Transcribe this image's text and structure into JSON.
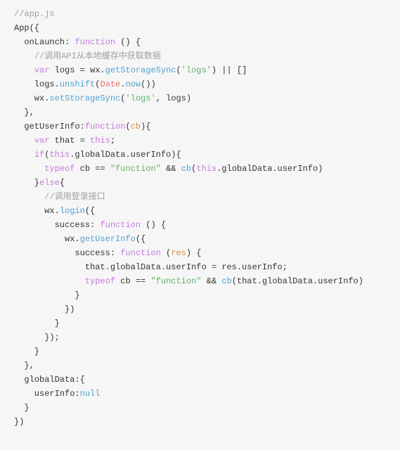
{
  "code": {
    "lines": [
      [
        [
          "c",
          "//app.js"
        ]
      ],
      [
        [
          "id",
          "App"
        ],
        [
          "op",
          "({"
        ]
      ],
      [
        [
          "id",
          "  onLaunch"
        ],
        [
          "op",
          ": "
        ],
        [
          "kw",
          "function"
        ],
        [
          "op",
          " () {"
        ]
      ],
      [
        [
          "c",
          "    //调用API从本地缓存中获取数据"
        ]
      ],
      [
        [
          "op",
          "    "
        ],
        [
          "kw",
          "var"
        ],
        [
          "op",
          " logs = wx."
        ],
        [
          "fn",
          "getStorageSync"
        ],
        [
          "op",
          "("
        ],
        [
          "s",
          "'logs'"
        ],
        [
          "op",
          ") || []"
        ]
      ],
      [
        [
          "op",
          "    logs."
        ],
        [
          "fn",
          "unshift"
        ],
        [
          "op",
          "("
        ],
        [
          "ob",
          "Date"
        ],
        [
          "op",
          "."
        ],
        [
          "fn",
          "now"
        ],
        [
          "op",
          "())"
        ]
      ],
      [
        [
          "op",
          "    wx."
        ],
        [
          "fn",
          "setStorageSync"
        ],
        [
          "op",
          "("
        ],
        [
          "s",
          "'logs'"
        ],
        [
          "op",
          ", logs)"
        ]
      ],
      [
        [
          "op",
          "  },"
        ]
      ],
      [
        [
          "id",
          "  getUserInfo"
        ],
        [
          "op",
          ":"
        ],
        [
          "kw",
          "function"
        ],
        [
          "op",
          "("
        ],
        [
          "pa",
          "cb"
        ],
        [
          "op",
          "){"
        ]
      ],
      [
        [
          "op",
          "    "
        ],
        [
          "kw",
          "var"
        ],
        [
          "op",
          " that = "
        ],
        [
          "kw",
          "this"
        ],
        [
          "op",
          ";"
        ]
      ],
      [
        [
          "op",
          "    "
        ],
        [
          "kw",
          "if"
        ],
        [
          "op",
          "("
        ],
        [
          "kw",
          "this"
        ],
        [
          "op",
          ".globalData.userInfo){"
        ]
      ],
      [
        [
          "op",
          "      "
        ],
        [
          "kw",
          "typeof"
        ],
        [
          "op",
          " cb == "
        ],
        [
          "s",
          "\"function\""
        ],
        [
          "op",
          " && "
        ],
        [
          "fn",
          "cb"
        ],
        [
          "op",
          "("
        ],
        [
          "kw",
          "this"
        ],
        [
          "op",
          ".globalData.userInfo)"
        ]
      ],
      [
        [
          "op",
          "    }"
        ],
        [
          "kw",
          "else"
        ],
        [
          "op",
          "{"
        ]
      ],
      [
        [
          "c",
          "      //调用登录接口"
        ]
      ],
      [
        [
          "op",
          "      wx."
        ],
        [
          "fn",
          "login"
        ],
        [
          "op",
          "({"
        ]
      ],
      [
        [
          "id",
          "        success"
        ],
        [
          "op",
          ": "
        ],
        [
          "kw",
          "function"
        ],
        [
          "op",
          " () {"
        ]
      ],
      [
        [
          "op",
          "          wx."
        ],
        [
          "fn",
          "getUserInfo"
        ],
        [
          "op",
          "({"
        ]
      ],
      [
        [
          "id",
          "            success"
        ],
        [
          "op",
          ": "
        ],
        [
          "kw",
          "function"
        ],
        [
          "op",
          " ("
        ],
        [
          "pa",
          "res"
        ],
        [
          "op",
          ") {"
        ]
      ],
      [
        [
          "op",
          "              that.globalData.userInfo = res.userInfo;"
        ]
      ],
      [
        [
          "op",
          "              "
        ],
        [
          "kw",
          "typeof"
        ],
        [
          "op",
          " cb == "
        ],
        [
          "s",
          "\"function\""
        ],
        [
          "op",
          " && "
        ],
        [
          "fn",
          "cb"
        ],
        [
          "op",
          "(that.globalData.userInfo)"
        ]
      ],
      [
        [
          "op",
          "            }"
        ]
      ],
      [
        [
          "op",
          "          })"
        ]
      ],
      [
        [
          "op",
          "        }"
        ]
      ],
      [
        [
          "op",
          "      });"
        ]
      ],
      [
        [
          "op",
          "    }"
        ]
      ],
      [
        [
          "op",
          "  },"
        ]
      ],
      [
        [
          "id",
          "  globalData"
        ],
        [
          "op",
          ":{"
        ]
      ],
      [
        [
          "id",
          "    userInfo"
        ],
        [
          "op",
          ":"
        ],
        [
          "kb",
          "null"
        ]
      ],
      [
        [
          "op",
          "  }"
        ]
      ],
      [
        [
          "op",
          "})"
        ]
      ]
    ]
  }
}
